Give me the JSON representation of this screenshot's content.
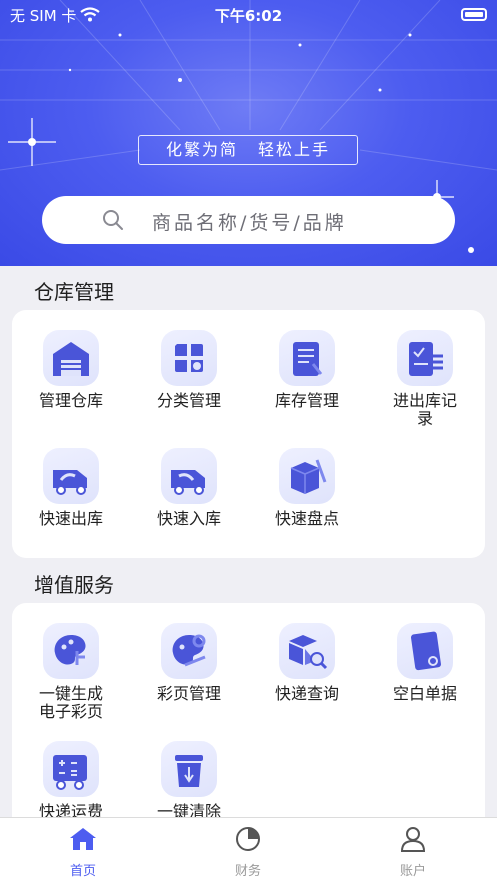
{
  "status_bar": {
    "carrier": "无 SIM 卡",
    "time": "下午6:02"
  },
  "banner": {
    "slogan_left": "化繁为简",
    "slogan_right": "轻松上手"
  },
  "search": {
    "placeholder": "商品名称/货号/品牌"
  },
  "warehouse": {
    "title": "仓库管理",
    "items": [
      {
        "label": "管理仓库",
        "icon": "warehouse-icon"
      },
      {
        "label": "分类管理",
        "icon": "category-icon"
      },
      {
        "label": "库存管理",
        "icon": "inventory-icon"
      },
      {
        "label": "进出库记录",
        "icon": "in-out-records-icon"
      },
      {
        "label": "快速出库",
        "icon": "truck-out-icon"
      },
      {
        "label": "快速入库",
        "icon": "truck-in-icon"
      },
      {
        "label": "快速盘点",
        "icon": "stocktake-icon"
      }
    ]
  },
  "value_added": {
    "title": "增值服务",
    "items": [
      {
        "label": "一键生成\n电子彩页",
        "icon": "palette-touch-icon"
      },
      {
        "label": "彩页管理",
        "icon": "palette-gear-icon"
      },
      {
        "label": "快递查询",
        "icon": "package-search-icon"
      },
      {
        "label": "空白单据",
        "icon": "blank-form-icon"
      },
      {
        "label": "快递运费",
        "icon": "shipping-calc-icon"
      },
      {
        "label": "一键清除",
        "icon": "trash-bin-icon"
      }
    ]
  },
  "tabbar": {
    "tabs": [
      {
        "label": "首页",
        "icon": "home-icon",
        "active": true
      },
      {
        "label": "财务",
        "icon": "pie-chart-icon",
        "active": false
      },
      {
        "label": "账户",
        "icon": "user-icon",
        "active": false
      }
    ]
  },
  "colors": {
    "accent": "#4d5df0",
    "icon_main": "#4a55d8",
    "tab_inactive": "#9a9a9a"
  }
}
